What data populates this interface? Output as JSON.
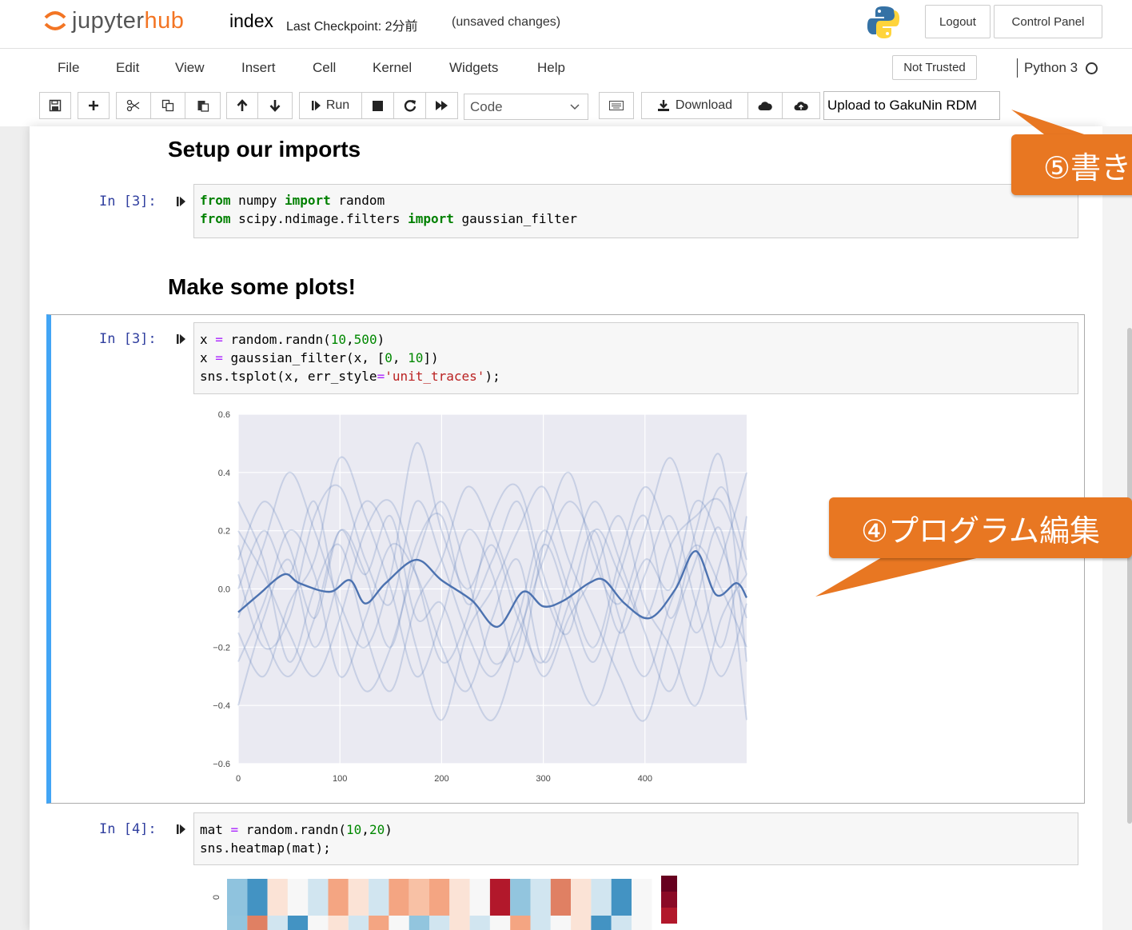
{
  "header": {
    "logo_prefix": "jupyter",
    "logo_suffix": "hub",
    "notebook_name": "index",
    "checkpoint": "Last Checkpoint: 2分前",
    "save_status": "(unsaved changes)",
    "logout_label": "Logout",
    "control_panel_label": "Control Panel"
  },
  "menubar": {
    "items": [
      "File",
      "Edit",
      "View",
      "Insert",
      "Cell",
      "Kernel",
      "Widgets",
      "Help"
    ],
    "trust_label": "Not Trusted",
    "kernel_name": "Python 3"
  },
  "toolbar": {
    "run_label": "Run",
    "cell_type": "Code",
    "download_label": "Download",
    "upload_label": "Upload to GakuNin RDM",
    "icons": [
      "save-icon",
      "plus-icon",
      "cut-icon",
      "copy-icon",
      "paste-icon",
      "arrow-up-icon",
      "arrow-down-icon",
      "run-icon",
      "stop-icon",
      "restart-icon",
      "fast-forward-icon",
      "keyboard-icon",
      "download-icon",
      "cloud-icon",
      "cloud-upload-icon"
    ]
  },
  "cells": {
    "h_imports": "Setup our imports",
    "h_plots": "Make some plots!",
    "c1_prompt": "In [3]:",
    "c2_prompt": "In [3]:",
    "c3_prompt": "In [4]:"
  },
  "annotations": {
    "callout_edit": "④プログラム編集",
    "callout_save": "⑤書き"
  },
  "chart_data": {
    "type": "line",
    "xlim": [
      0,
      500
    ],
    "ylim": [
      -0.6,
      0.6
    ],
    "x_ticks": [
      "0",
      "100",
      "200",
      "300",
      "400"
    ],
    "y_ticks": [
      "0.6",
      "0.4",
      "0.2",
      "0.0",
      "−0.2",
      "−0.4",
      "−0.6"
    ],
    "grid": true,
    "background": "#eaeaf2",
    "line_color": "#4c72b0",
    "mean": {
      "x": [
        0,
        20,
        45,
        60,
        90,
        110,
        125,
        145,
        175,
        200,
        230,
        255,
        280,
        300,
        320,
        345,
        360,
        380,
        405,
        430,
        450,
        470,
        490,
        500
      ],
      "y": [
        -0.08,
        -0.02,
        0.05,
        0.02,
        -0.01,
        0.03,
        -0.05,
        0.02,
        0.1,
        0.03,
        -0.04,
        -0.13,
        -0.01,
        -0.06,
        -0.04,
        0.02,
        0.03,
        -0.05,
        -0.1,
        0.0,
        0.13,
        -0.02,
        0.02,
        -0.03
      ]
    },
    "unit_traces": [
      [
        0.1,
        0.3,
        0.15,
        -0.1,
        0.2,
        0.05,
        -0.2,
        0.15,
        0.25,
        -0.05,
        0.1,
        0.3,
        0.0,
        -0.15,
        0.2,
        0.05,
        -0.1,
        0.15,
        0.25,
        0.3,
        0.05
      ],
      [
        -0.25,
        -0.05,
        0.2,
        0.05,
        -0.3,
        -0.1,
        0.15,
        0.05,
        -0.2,
        -0.35,
        -0.1,
        0.1,
        -0.25,
        -0.05,
        0.2,
        -0.1,
        -0.3,
        -0.05,
        0.15,
        0.0,
        -0.2
      ],
      [
        0.05,
        -0.2,
        -0.1,
        0.25,
        0.35,
        0.1,
        -0.05,
        0.3,
        0.1,
        -0.15,
        -0.3,
        -0.1,
        0.2,
        0.0,
        -0.2,
        0.1,
        0.35,
        0.15,
        -0.15,
        0.1,
        0.4
      ],
      [
        -0.1,
        0.15,
        0.4,
        0.2,
        -0.05,
        -0.2,
        0.05,
        0.5,
        0.2,
        0.0,
        0.15,
        -0.1,
        -0.25,
        0.05,
        0.3,
        0.1,
        -0.15,
        -0.35,
        -0.05,
        0.2,
        -0.45
      ],
      [
        0.2,
        0.05,
        -0.15,
        -0.3,
        -0.1,
        0.2,
        0.3,
        0.05,
        -0.25,
        -0.1,
        0.25,
        0.35,
        0.05,
        -0.2,
        -0.4,
        -0.15,
        0.1,
        0.0,
        0.3,
        0.15,
        -0.1
      ],
      [
        -0.15,
        -0.3,
        -0.05,
        0.1,
        0.45,
        0.25,
        0.0,
        -0.3,
        -0.1,
        0.2,
        0.05,
        -0.25,
        0.15,
        0.4,
        0.1,
        -0.05,
        0.2,
        0.45,
        0.15,
        -0.2,
        0.25
      ],
      [
        0.3,
        0.1,
        -0.25,
        0.0,
        0.15,
        -0.15,
        -0.35,
        -0.05,
        0.1,
        0.35,
        0.2,
        -0.05,
        -0.3,
        -0.1,
        0.05,
        0.25,
        -0.05,
        -0.2,
        -0.4,
        -0.1,
        0.05
      ],
      [
        -0.4,
        -0.1,
        0.1,
        -0.2,
        0.05,
        0.3,
        0.15,
        -0.2,
        -0.45,
        -0.15,
        0.0,
        0.2,
        0.35,
        0.1,
        -0.1,
        -0.3,
        -0.45,
        -0.15,
        0.1,
        0.35,
        0.1
      ],
      [
        0.0,
        0.2,
        0.05,
        0.3,
        -0.1,
        -0.35,
        -0.2,
        0.1,
        0.3,
        0.05,
        -0.25,
        -0.15,
        0.1,
        0.3,
        0.15,
        -0.15,
        0.05,
        0.25,
        -0.05,
        -0.3,
        -0.05
      ],
      [
        0.15,
        -0.15,
        -0.3,
        -0.1,
        0.2,
        0.05,
        0.25,
        -0.1,
        -0.05,
        -0.3,
        -0.45,
        -0.2,
        0.15,
        -0.05,
        -0.25,
        0.05,
        0.25,
        -0.1,
        0.2,
        0.45,
        -0.25
      ]
    ]
  },
  "heatmap_data": {
    "row0": [
      "#8fc3de",
      "#4393c3",
      "#fbe3d6",
      "#f7f7f7",
      "#d1e5f0",
      "#f4a582",
      "#fbe3d6",
      "#d1e5f0",
      "#f4a582",
      "#f8c1a5",
      "#f4a582",
      "#fbe3d6",
      "#f7f7f7",
      "#b2182b",
      "#92c5de",
      "#d1e5f0",
      "#e08063",
      "#fbe3d6",
      "#d1e5f0",
      "#4393c3",
      "#f7f7f7"
    ],
    "row1": [
      "#92c5de",
      "#e08063",
      "#d1e5f0",
      "#4393c3",
      "#f7f7f7",
      "#fbe3d6",
      "#d1e5f0",
      "#f4a582",
      "#f7f7f7",
      "#92c5de",
      "#d1e5f0",
      "#fbe3d6",
      "#d1e5f0",
      "#f7f7f7",
      "#f4a582",
      "#d1e5f0",
      "#f7f7f7",
      "#fbe3d6",
      "#4393c3",
      "#d1e5f0",
      "#f7f7f7"
    ],
    "colorbar": [
      "#67001f",
      "#8b0a26",
      "#b2182b"
    ],
    "ytick0": "0"
  }
}
